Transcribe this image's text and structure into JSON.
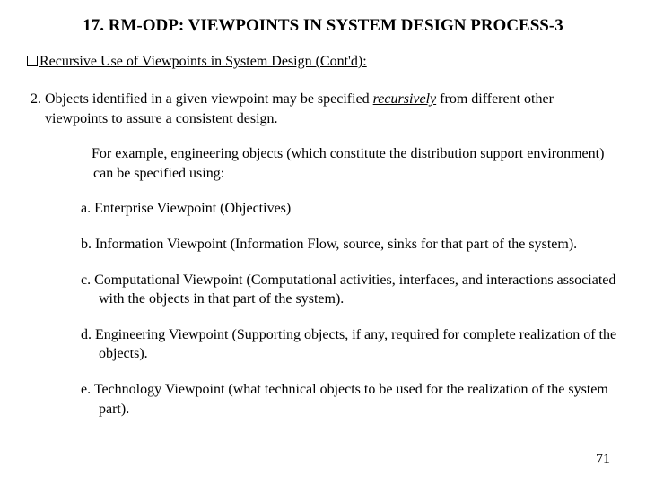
{
  "title": "17. RM-ODP: VIEWPOINTS IN SYSTEM DESIGN PROCESS-3",
  "subhead_prefix": "Recursive Use of Viewpoints in System Design (Cont'd):",
  "para2_a": "2. Objects identified in a given viewpoint may be specified ",
  "para2_rec": "recursively",
  "para2_b": " from different other viewpoints to assure a consistent design.",
  "example_intro": "For example, engineering objects (which constitute the distribution support environment) can be specified using:",
  "items": {
    "a": "a. Enterprise Viewpoint (Objectives)",
    "b": "b. Information Viewpoint (Information Flow, source, sinks for that part of the system).",
    "c": "c. Computational Viewpoint (Computational activities, interfaces, and interactions associated with the objects in that part of the system).",
    "d": "d. Engineering Viewpoint (Supporting objects, if any, required for complete realization of the objects).",
    "e": "e. Technology Viewpoint (what technical objects to be used for the realization of the system part)."
  },
  "page_number": "71"
}
